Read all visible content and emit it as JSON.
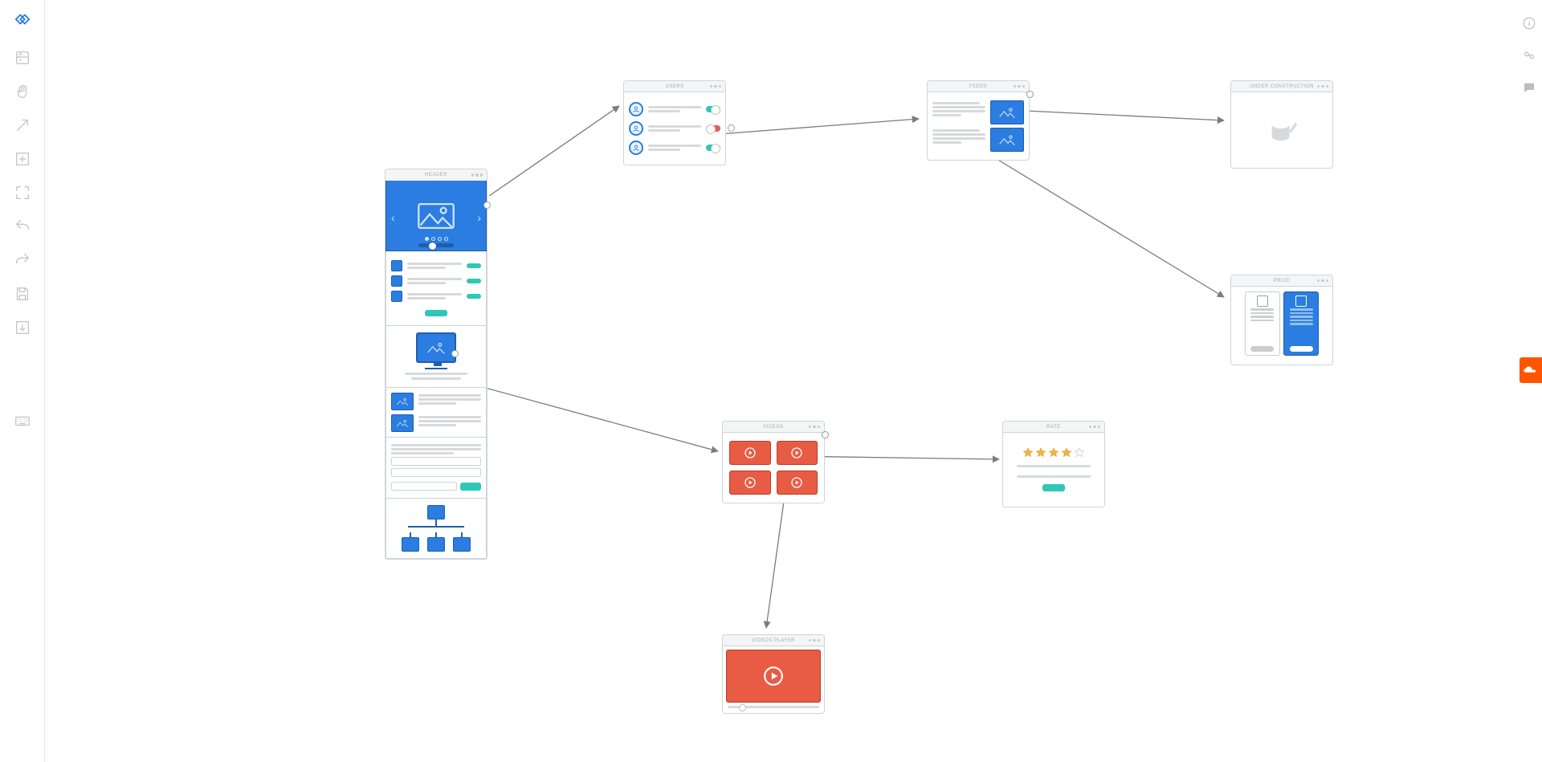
{
  "toolbar_left": [
    "logo",
    "library",
    "hand",
    "arrow",
    "zoom-in",
    "zoom-fit",
    "undo",
    "redo",
    "save",
    "export",
    "keyboard"
  ],
  "toolbar_right": [
    "info",
    "share",
    "comments"
  ],
  "wireframes": {
    "header": {
      "title": "HEADER"
    },
    "users": {
      "title": "USERS"
    },
    "feeds": {
      "title": "FEEDS"
    },
    "under": {
      "title": "UNDER CONSTRUCTION"
    },
    "price": {
      "title": "PRICE"
    },
    "videos": {
      "title": "VIDEOS"
    },
    "rate": {
      "title": "RATE",
      "stars_filled": 4,
      "stars_total": 5
    },
    "player": {
      "title": "VIDEOS PLAYER"
    }
  },
  "accent": {
    "blue": "#2b7de1",
    "teal": "#2fc7b5",
    "red": "#e85b44",
    "orange": "#ff5500"
  }
}
